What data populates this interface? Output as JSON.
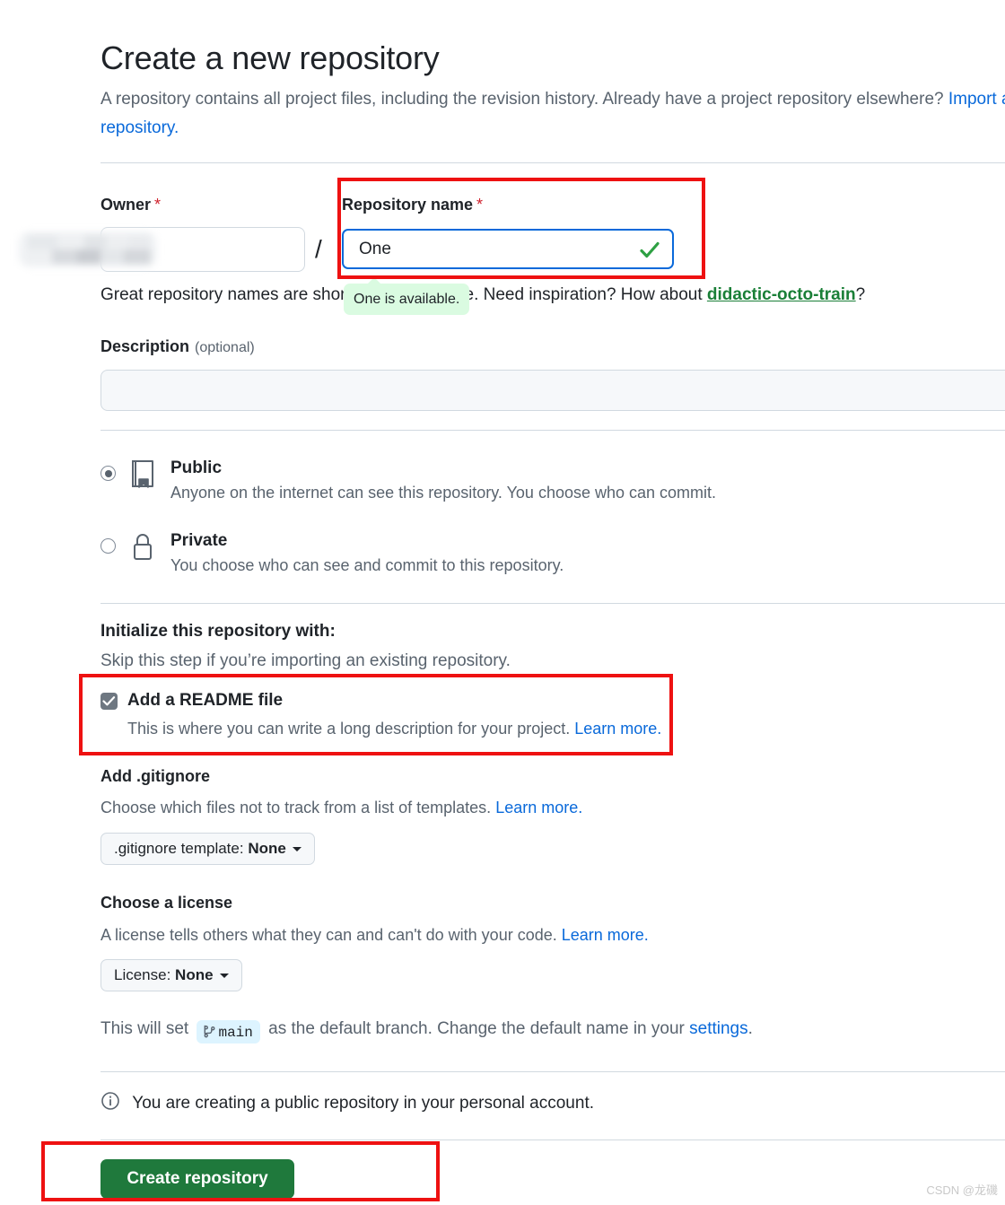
{
  "header": {
    "title": "Create a new repository",
    "intro_part1": "A repository contains all project files, including the revision history. Already have a project repository elsewhere?",
    "import_link": "Import a repository."
  },
  "owner": {
    "label": "Owner",
    "required_marker": "*",
    "value": "",
    "separator": "/"
  },
  "repo_name": {
    "label": "Repository name",
    "required_marker": "*",
    "value": "One",
    "valid_icon": "green-check-icon",
    "availability_message": "One is available.",
    "helper_text": "Great repository names are short and memorable. Need inspiration? How about ",
    "helper_suggestion": "didactic-octo-train",
    "helper_tail": "?"
  },
  "description": {
    "label": "Description",
    "optional_note": "(optional)",
    "value": "",
    "placeholder": ""
  },
  "visibility": {
    "options": [
      {
        "id": "public",
        "title": "Public",
        "description": "Anyone on the internet can see this repository. You choose who can commit.",
        "icon": "book-icon",
        "selected": true
      },
      {
        "id": "private",
        "title": "Private",
        "description": "You choose who can see and commit to this repository.",
        "icon": "lock-icon",
        "selected": false
      }
    ]
  },
  "initialize": {
    "heading": "Initialize this repository with:",
    "subtext": "Skip this step if you’re importing an existing repository.",
    "readme": {
      "label": "Add a README file",
      "checked": true,
      "description": "This is where you can write a long description for your project. ",
      "learn_more": "Learn more."
    }
  },
  "gitignore": {
    "heading": "Add .gitignore",
    "description": "Choose which files not to track from a list of templates. ",
    "learn_more": "Learn more.",
    "select_prefix": ".gitignore template: ",
    "select_value": "None"
  },
  "license": {
    "heading": "Choose a license",
    "description": "A license tells others what they can and can't do with your code. ",
    "learn_more": "Learn more.",
    "select_prefix": "License: ",
    "select_value": "None"
  },
  "branch": {
    "prefix": "This will set ",
    "branch_name": "main",
    "middle": " as the default branch. Change the default name in your ",
    "settings_link": "settings",
    "suffix": "."
  },
  "notice": {
    "icon": "info-icon",
    "text": "You are creating a public repository in your personal account."
  },
  "actions": {
    "create_label": "Create repository"
  },
  "annotations": {
    "color": "#ee1111",
    "boxes": [
      "repository-name-field",
      "add-readme-file",
      "create-repository-button"
    ]
  },
  "watermark": "CSDN @龙磯"
}
